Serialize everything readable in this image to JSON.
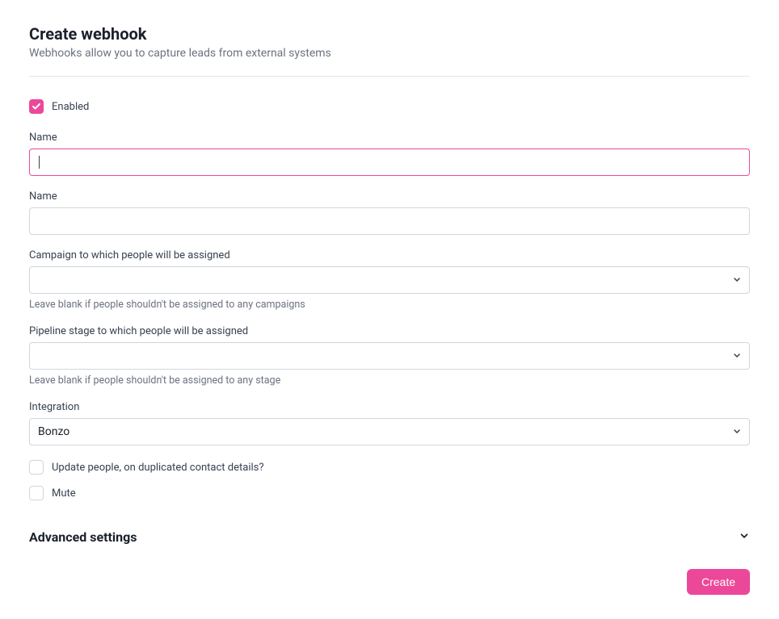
{
  "header": {
    "title": "Create webhook",
    "subtitle": "Webhooks allow you to capture leads from external systems"
  },
  "enabled": {
    "label": "Enabled",
    "checked": true
  },
  "fields": {
    "name1": {
      "label": "Name",
      "value": ""
    },
    "name2": {
      "label": "Name",
      "value": ""
    },
    "campaign": {
      "label": "Campaign to which people will be assigned",
      "value": "",
      "helper": "Leave blank if people shouldn't be assigned to any campaigns"
    },
    "pipeline": {
      "label": "Pipeline stage to which people will be assigned",
      "value": "",
      "helper": "Leave blank if people shouldn't be assigned to any stage"
    },
    "integration": {
      "label": "Integration",
      "value": "Bonzo"
    }
  },
  "checkboxes": {
    "updatePeople": {
      "label": "Update people, on duplicated contact details?",
      "checked": false
    },
    "mute": {
      "label": "Mute",
      "checked": false
    }
  },
  "advanced": {
    "title": "Advanced settings"
  },
  "footer": {
    "createLabel": "Create"
  }
}
